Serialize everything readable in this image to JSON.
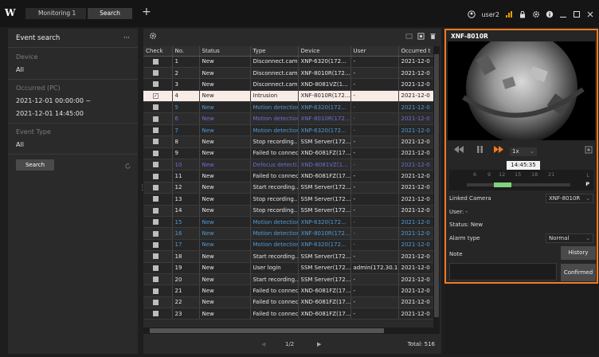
{
  "topbar": {
    "logo": "W",
    "tabs": [
      {
        "label": "Monitoring 1"
      },
      {
        "label": "Search"
      }
    ],
    "add_tab": "+",
    "user": "user2"
  },
  "left": {
    "title": "Event search",
    "menu": "···",
    "device_label": "Device",
    "device_value": "All",
    "occurred_label": "Occurred (PC)",
    "occurred_from": "2021-12-01 00:00:00 ~",
    "occurred_to": "2021-12-01 14:45:00",
    "event_type_label": "Event Type",
    "event_type_value": "All",
    "search_button": "Search"
  },
  "table": {
    "columns": [
      "Check",
      "No.",
      "Status",
      "Type",
      "Device",
      "User",
      "Occurred t"
    ],
    "rows": [
      {
        "check": false,
        "no": "1",
        "status": "New",
        "type": "Disconnect.cam...",
        "device": "XNP-6320(172...",
        "user": "-",
        "occurred": "2021-12-0",
        "style": "normal"
      },
      {
        "check": false,
        "no": "2",
        "status": "New",
        "type": "Disconnect.cam...",
        "device": "XNF-8010R(172...",
        "user": "-",
        "occurred": "2021-12-0",
        "style": "normal"
      },
      {
        "check": false,
        "no": "3",
        "status": "New",
        "type": "Disconnect.cam...",
        "device": "XND-8081VZ(1...",
        "user": "-",
        "occurred": "2021-12-0",
        "style": "normal"
      },
      {
        "check": true,
        "no": "4",
        "status": "New",
        "type": "Intrusion",
        "device": "XNF-8010R(172...",
        "user": "-",
        "occurred": "2021-12-0",
        "style": "selected"
      },
      {
        "check": false,
        "no": "5",
        "status": "New",
        "type": "Motion detection",
        "device": "XNP-6320(172...",
        "user": "-",
        "occurred": "2021-12-0",
        "style": "motion"
      },
      {
        "check": false,
        "no": "6",
        "status": "New",
        "type": "Motion detection",
        "device": "XNF-8010R(172...",
        "user": "-",
        "occurred": "2021-12-0",
        "style": "defocus"
      },
      {
        "check": false,
        "no": "7",
        "status": "New",
        "type": "Motion detection",
        "device": "XNP-6320(172...",
        "user": "-",
        "occurred": "2021-12-0",
        "style": "motion"
      },
      {
        "check": false,
        "no": "8",
        "status": "New",
        "type": "Stop recording...",
        "device": "SSM Server(172...",
        "user": "-",
        "occurred": "2021-12-0",
        "style": "normal"
      },
      {
        "check": false,
        "no": "9",
        "status": "New",
        "type": "Failed to connect...",
        "device": "XND-6081FZ(17...",
        "user": "-",
        "occurred": "2021-12-0",
        "style": "normal"
      },
      {
        "check": false,
        "no": "10",
        "status": "New",
        "type": "Defocus detecti...",
        "device": "XND-8081VZ(1...",
        "user": "-",
        "occurred": "2021-12-0",
        "style": "defocus"
      },
      {
        "check": false,
        "no": "11",
        "status": "New",
        "type": "Failed to connect...",
        "device": "XND-6081FZ(17...",
        "user": "-",
        "occurred": "2021-12-0",
        "style": "normal"
      },
      {
        "check": false,
        "no": "12",
        "status": "New",
        "type": "Start recording...",
        "device": "SSM Server(172...",
        "user": "-",
        "occurred": "2021-12-0",
        "style": "normal"
      },
      {
        "check": false,
        "no": "13",
        "status": "New",
        "type": "Stop recording...",
        "device": "SSM Server(172...",
        "user": "-",
        "occurred": "2021-12-0",
        "style": "normal"
      },
      {
        "check": false,
        "no": "14",
        "status": "New",
        "type": "Stop recording...",
        "device": "SSM Server(172...",
        "user": "-",
        "occurred": "2021-12-0",
        "style": "normal"
      },
      {
        "check": false,
        "no": "15",
        "status": "New",
        "type": "Motion detection",
        "device": "XNP-6320(172...",
        "user": "-",
        "occurred": "2021-12-0",
        "style": "motion"
      },
      {
        "check": false,
        "no": "16",
        "status": "New",
        "type": "Motion detection",
        "device": "XNF-8010R(172...",
        "user": "-",
        "occurred": "2021-12-0",
        "style": "motion"
      },
      {
        "check": false,
        "no": "17",
        "status": "New",
        "type": "Motion detection",
        "device": "XNP-6320(172...",
        "user": "-",
        "occurred": "2021-12-0",
        "style": "motion"
      },
      {
        "check": false,
        "no": "18",
        "status": "New",
        "type": "Start recording...",
        "device": "SSM Server(172...",
        "user": "-",
        "occurred": "2021-12-0",
        "style": "normal"
      },
      {
        "check": false,
        "no": "19",
        "status": "New",
        "type": "User login",
        "device": "SSM Server(172...",
        "user": "admin(172.30.1...",
        "occurred": "2021-12-0",
        "style": "normal"
      },
      {
        "check": false,
        "no": "20",
        "status": "New",
        "type": "Start recording...",
        "device": "SSM Server(172...",
        "user": "-",
        "occurred": "2021-12-0",
        "style": "normal"
      },
      {
        "check": false,
        "no": "21",
        "status": "New",
        "type": "Failed to connect...",
        "device": "XND-6081FZ(17...",
        "user": "-",
        "occurred": "2021-12-0",
        "style": "normal"
      },
      {
        "check": false,
        "no": "22",
        "status": "New",
        "type": "Failed to connect...",
        "device": "XND-6081FZ(17...",
        "user": "-",
        "occurred": "2021-12-0",
        "style": "normal"
      },
      {
        "check": false,
        "no": "23",
        "status": "New",
        "type": "Failed to connect...",
        "device": "XND-6081FZ(17...",
        "user": "-",
        "occurred": "2021-12-0",
        "style": "normal"
      }
    ]
  },
  "pager": {
    "page": "1/2",
    "total": "Total: 516"
  },
  "right": {
    "camera_title": "XNF-8010R",
    "speed": "1x",
    "tooltip_time": "14:45:35",
    "timeline_hours": [
      "6",
      "9",
      "12",
      "15",
      "18",
      "21"
    ],
    "timeline_L": "L",
    "timeline_P": "P",
    "linked_camera_label": "Linked Camera",
    "linked_camera_value": "XNF-8010R",
    "user_text": "User: -",
    "status_text": "Status: New",
    "alarm_type_label": "Alarm type",
    "alarm_type_value": "Normal",
    "note_label": "Note",
    "history_button": "History",
    "confirmed_button": "Confirmed"
  },
  "colors": {
    "accent": "#f07b22",
    "motion_text": "#4f9ad6",
    "defocus_text": "#6d6dd8",
    "selected_row": "#f7ece6",
    "timeline_green": "#7ed37e"
  }
}
